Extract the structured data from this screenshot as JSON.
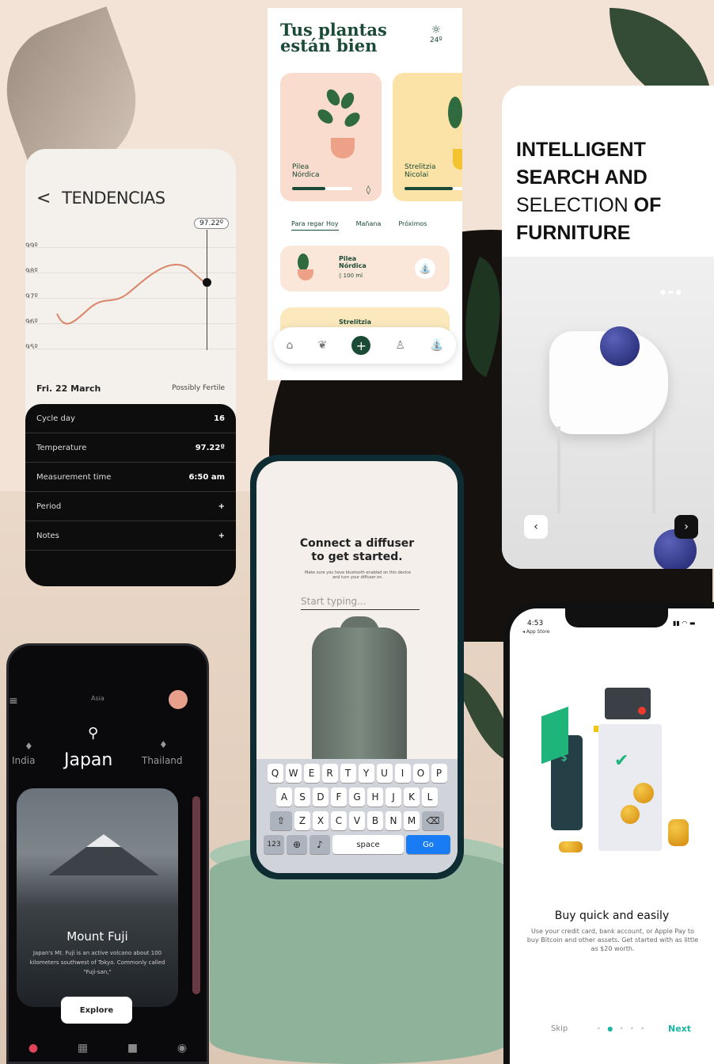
{
  "tendencias": {
    "title": "TENDENCIAS",
    "chevron": "<",
    "temp_badge": "97.22º",
    "y_ticks": [
      "99º",
      "98º",
      "97º",
      "96º",
      "95º"
    ],
    "date": "Fri. 22 March",
    "fertility": "Possibly Fertile",
    "rows": [
      {
        "label": "Cycle day",
        "value": "16"
      },
      {
        "label": "Temperature",
        "value": "97.22º"
      },
      {
        "label": "Measurement time",
        "value": "6:50 am"
      },
      {
        "label": "Period",
        "value": "+"
      },
      {
        "label": "Notes",
        "value": "+"
      }
    ]
  },
  "plantas": {
    "title_line1": "Tus plantas",
    "title_line2": "están bien",
    "weather_temp": "24º",
    "card1_name_line1": "Pilea",
    "card1_name_line2": "Nórdica",
    "card1_drop": "◊",
    "card2_name_line1": "Strelitzia",
    "card2_name_line2": "Nicolai",
    "tabs": [
      "Para regar Hoy",
      "Mañana",
      "Próximos"
    ],
    "list1_name_line1": "Pilea",
    "list1_name_line2": "Nórdica",
    "list1_amount": "◊ 100 ml",
    "list2_name": "Strelitzia",
    "progress1": 0.55,
    "progress2": 0.8
  },
  "furniture": {
    "line1": "INTELLIGENT",
    "line2": "SEARCH AND",
    "line3a": "SELECTION",
    "line3b": "OF",
    "line4": "FURNITURE",
    "prev": "‹",
    "next": "›"
  },
  "diffuser": {
    "title_line1": "Connect a diffuser",
    "title_line2": "to get started.",
    "subtitle": "Make sure you have bluetooth enabled on this device and turn your diffuser on.",
    "input_placeholder": "Start typing...",
    "kb_row1": [
      "Q",
      "W",
      "E",
      "R",
      "T",
      "Y",
      "U",
      "I",
      "O",
      "P"
    ],
    "kb_row2": [
      "A",
      "S",
      "D",
      "F",
      "G",
      "H",
      "J",
      "K",
      "L"
    ],
    "kb_row3": [
      "Z",
      "X",
      "C",
      "V",
      "B",
      "N",
      "M"
    ],
    "kb_123": "123",
    "kb_space": "space",
    "kb_go": "Go"
  },
  "travel": {
    "region": "Asia",
    "countries": [
      "India",
      "Japan",
      "Thailand"
    ],
    "place": "Mount Fuji",
    "description": "Japan's Mt. Fuji is an active volcano about 100 kilometers southwest of Tokyo. Commonly called \"Fuji-san,\"",
    "explore": "Explore"
  },
  "crypto": {
    "time": "4:53",
    "back_label": "◂ App Store",
    "title": "Buy quick and easily",
    "description": "Use your credit card, bank account, or Apple Pay to buy Bitcoin and other assets. Get started with as little as $20 worth.",
    "skip": "Skip",
    "next": "Next"
  },
  "colors": {
    "plant_green": "#1b4a36",
    "teal": "#1cb5a3",
    "go_blue": "#1a7cf5"
  }
}
